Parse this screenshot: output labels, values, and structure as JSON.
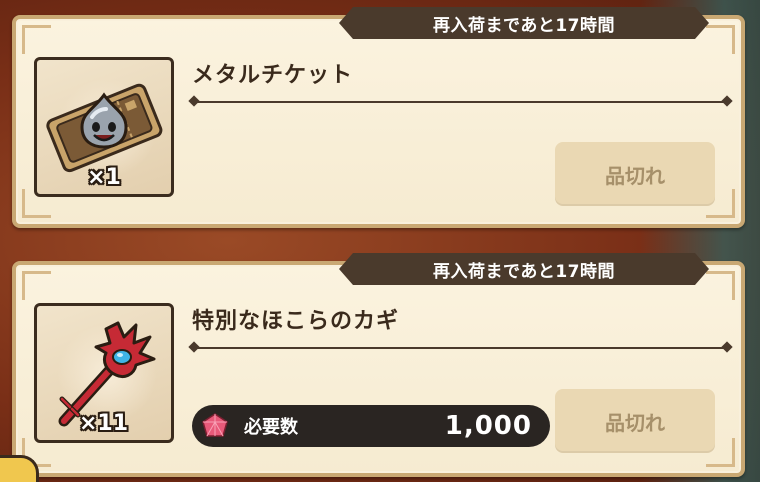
{
  "colors": {
    "panel_bg": "#f6ebd1",
    "panel_border": "#c9a873",
    "banner_bg": "#4a3a2c",
    "soldout_bg": "#ead8b3",
    "soldout_text": "#a6906a",
    "cost_bg": "#2a2522"
  },
  "items": [
    {
      "restock_label": "再入荷まであと17時間",
      "name": "メタルチケット",
      "quantity": "×1",
      "icon": "metal-ticket-icon",
      "button_label": "品切れ"
    },
    {
      "restock_label": "再入荷まであと17時間",
      "name": "特別なほこらのカギ",
      "quantity": "×11",
      "icon": "shrine-key-icon",
      "cost_label": "必要数",
      "cost_icon": "gem-icon",
      "cost_amount": "1,000",
      "button_label": "品切れ"
    }
  ]
}
